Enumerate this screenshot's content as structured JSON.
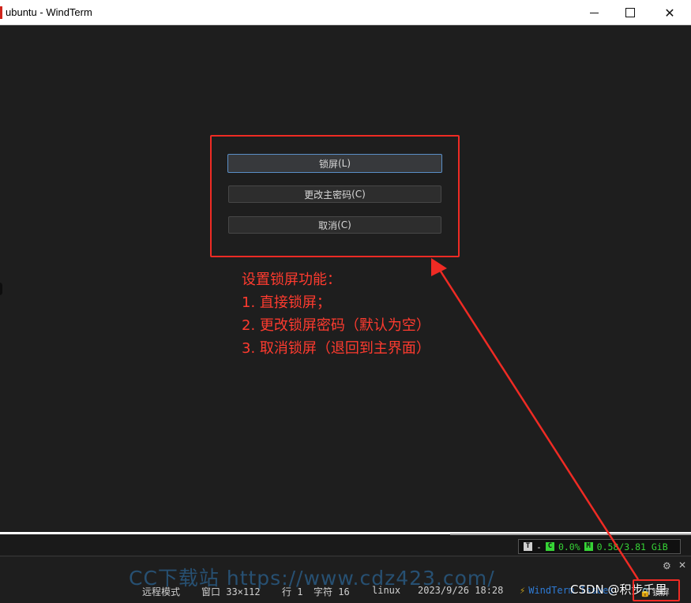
{
  "window": {
    "title": "ubuntu - WindTerm",
    "minimize_glyph": "",
    "maximize_glyph": "",
    "close_glyph": "✕"
  },
  "dialog": {
    "lock_label": "锁屏",
    "lock_key": "(L)",
    "change_label": "更改主密码",
    "change_key": "(C)",
    "cancel_label": "取消",
    "cancel_key": "(C)"
  },
  "annotation": {
    "heading": "设置锁屏功能：",
    "item1": "1. 直接锁屏；",
    "item2": "2. 更改锁屏密码（默认为空）",
    "item3": "3. 取消锁屏（退回到主界面）",
    "color": "#ef2b24"
  },
  "sysinfo": {
    "t_tag": "T",
    "dash": "-",
    "c_tag": "C",
    "cpu": "0.0%",
    "m_tag": "M",
    "memory": "0.58/3.81 GiB"
  },
  "panel": {
    "gear_icon": "⚙",
    "close_icon": "✕"
  },
  "watermark": "CC下载站 https://www.cdz423.com/",
  "statusbar": {
    "mode": "远程模式",
    "window_size": "窗口 33×112",
    "row": "行 1",
    "col": "字符 16",
    "os": "linux",
    "datetime": "2023/9/26 18:28",
    "brand": "WindTerm Issues",
    "csdn": "CSDN @积步千里",
    "lock": "锁屏"
  }
}
